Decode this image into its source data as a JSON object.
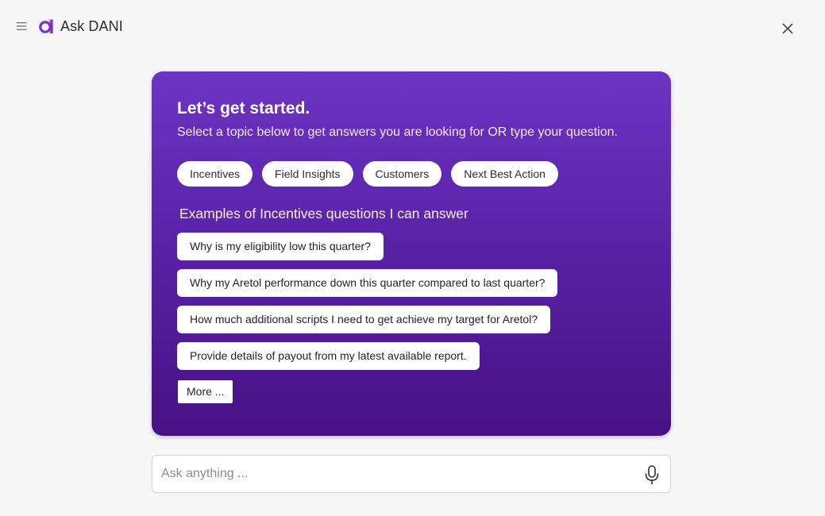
{
  "header": {
    "title": "Ask DANI",
    "menu_icon": "hamburger-menu-icon",
    "logo_icon": "dani-logo-icon",
    "close_icon": "close-icon",
    "brand_color": "#7b2fd1"
  },
  "card": {
    "heading": "Let’s get started.",
    "subheading": "Select a topic below to get answers you are looking for OR type your question.",
    "gradient_top": "#6d34c4",
    "gradient_bottom": "#481184",
    "topics": [
      {
        "label": "Incentives"
      },
      {
        "label": "Field Insights"
      },
      {
        "label": "Customers"
      },
      {
        "label": "Next Best Action"
      }
    ],
    "examples_heading": "Examples of Incentives questions I can answer",
    "questions": [
      {
        "label": "Why is my eligibility low this quarter?"
      },
      {
        "label": "Why my Aretol performance down this quarter compared to last quarter?"
      },
      {
        "label": "How much additional scripts I need to get achieve my target for Aretol?"
      },
      {
        "label": "Provide details of payout from my latest available report."
      }
    ],
    "more_label": "More ..."
  },
  "ask": {
    "placeholder": "Ask anything ...",
    "value": "",
    "mic_icon": "microphone-icon"
  }
}
